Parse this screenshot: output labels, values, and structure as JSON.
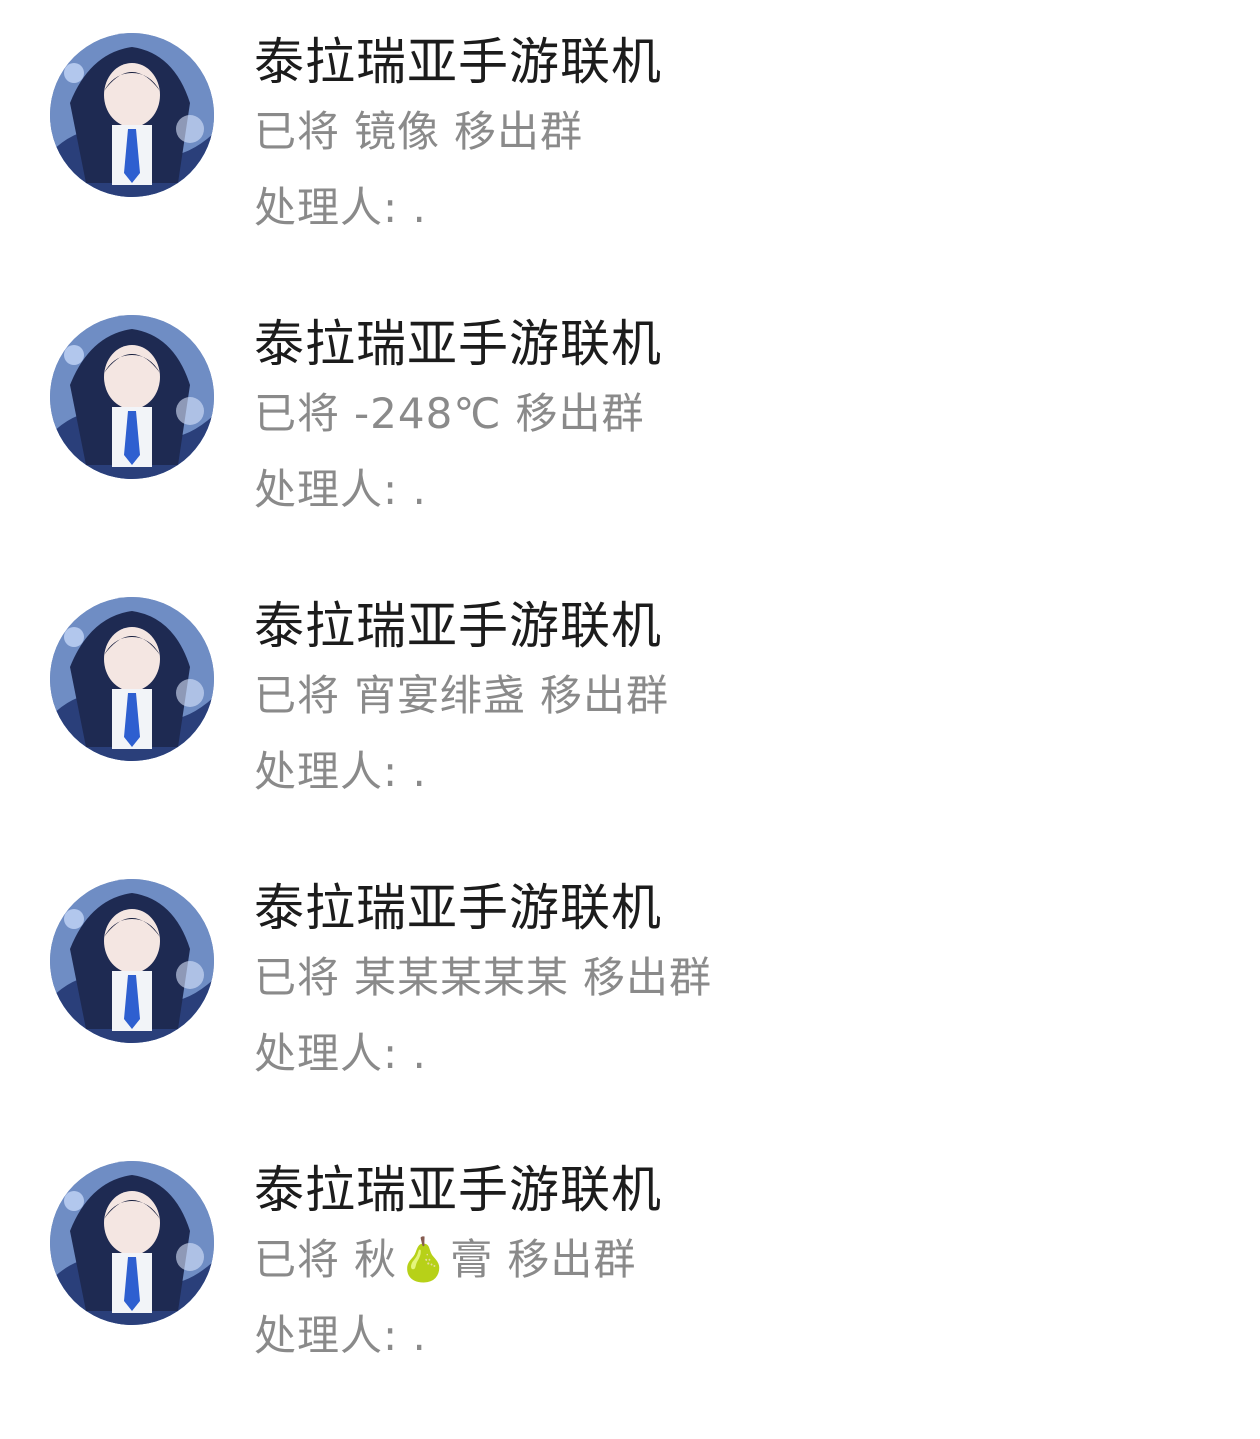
{
  "notifications": [
    {
      "group_name": "泰拉瑞亚手游联机",
      "action_prefix": "已将",
      "member": "镜像",
      "action_suffix": "移出群",
      "handler": "处理人: ."
    },
    {
      "group_name": "泰拉瑞亚手游联机",
      "action_prefix": "已将",
      "member": "-248℃",
      "action_suffix": "移出群",
      "handler": "处理人: ."
    },
    {
      "group_name": "泰拉瑞亚手游联机",
      "action_prefix": "已将",
      "member": "宵宴绯盏",
      "action_suffix": "移出群",
      "handler": "处理人: ."
    },
    {
      "group_name": "泰拉瑞亚手游联机",
      "action_prefix": "已将",
      "member": "某某某某某",
      "action_suffix": "移出群",
      "handler": "处理人: ."
    },
    {
      "group_name": "泰拉瑞亚手游联机",
      "action_prefix": "已将",
      "member": "秋🍐膏",
      "action_suffix": "移出群",
      "handler": "处理人: ."
    }
  ],
  "avatar_icon": "anime-girl-group-avatar",
  "colors": {
    "title": "#1c1c1c",
    "secondary": "#8a8a8a",
    "background": "#ffffff"
  }
}
